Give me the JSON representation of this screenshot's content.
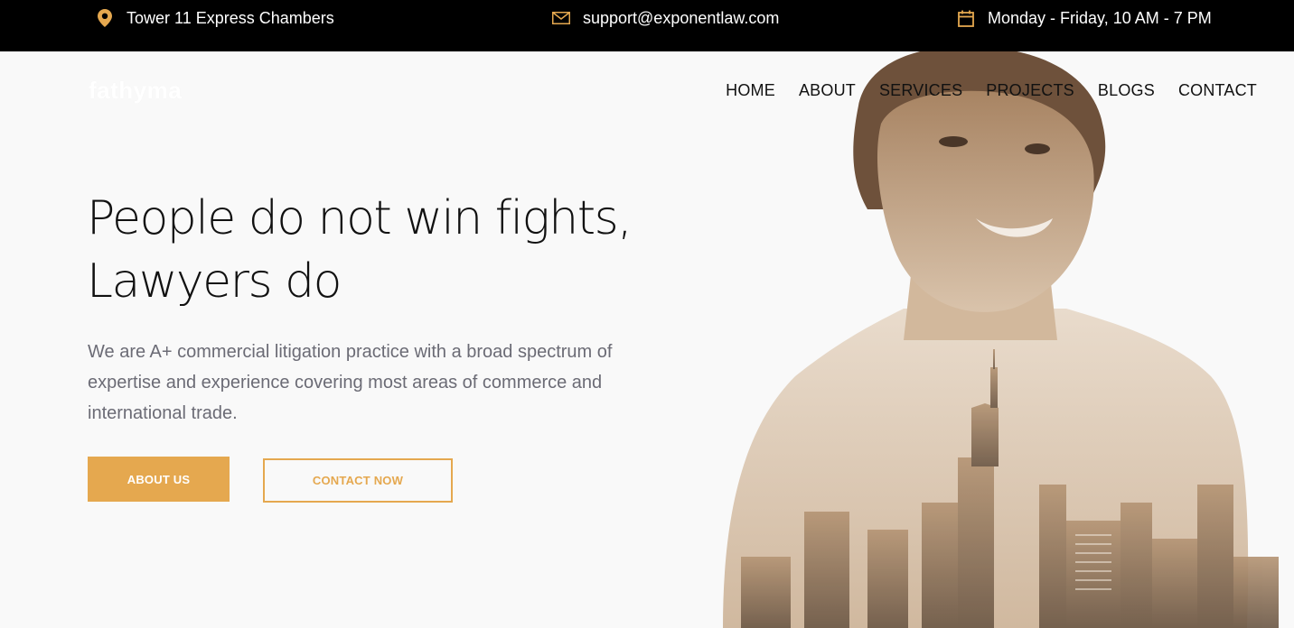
{
  "topbar": {
    "address": {
      "icon": "map-pin-icon",
      "text": "Tower 11 Express Chambers"
    },
    "email": {
      "icon": "envelope-icon",
      "text": "support@exponentlaw.com"
    },
    "hours": {
      "icon": "calendar-icon",
      "text": "Monday - Friday, 10 AM - 7 PM"
    }
  },
  "header": {
    "logo": "fathyma",
    "nav": [
      "HOME",
      "ABOUT",
      "SERVICES",
      "PROJECTS",
      "BLOGS",
      "CONTACT"
    ]
  },
  "hero": {
    "headline_line1": "People do not win fights,",
    "headline_line2": "Lawyers do",
    "lead": "We are A+ commercial litigation practice with a broad spectrum of expertise and experience covering most areas of commerce and international trade.",
    "primary_button": "ABOUT US",
    "secondary_button": "CONTACT NOW"
  },
  "colors": {
    "accent": "#e5a84f",
    "topbar_bg": "#000000",
    "page_bg": "#f9f9f9",
    "portrait_tone": "#b99a7a"
  }
}
